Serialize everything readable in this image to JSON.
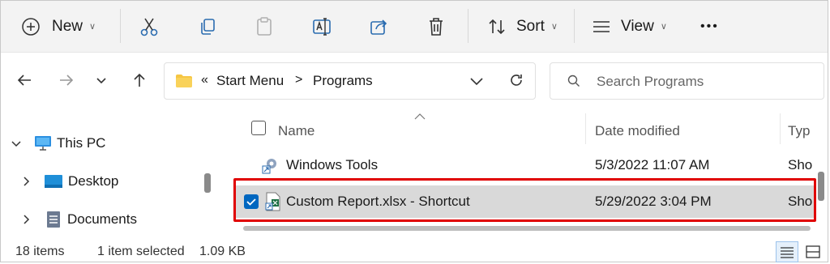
{
  "toolbar": {
    "new_label": "New",
    "sort_label": "Sort",
    "view_label": "View",
    "more_label": "•••"
  },
  "address": {
    "overflow": "«",
    "crumbs": [
      "Start Menu",
      "Programs"
    ],
    "separator": ">"
  },
  "search": {
    "placeholder": "Search Programs"
  },
  "nav": {
    "items": [
      {
        "label": "This PC",
        "expanded": true
      },
      {
        "label": "Desktop",
        "expanded": false
      },
      {
        "label": "Documents",
        "expanded": false
      }
    ]
  },
  "columns": {
    "name": "Name",
    "date": "Date modified",
    "type": "Typ"
  },
  "files": [
    {
      "name": "Windows Tools",
      "date": "5/3/2022 11:07 AM",
      "type": "Sho",
      "selected": false
    },
    {
      "name": "Custom Report.xlsx - Shortcut",
      "date": "5/29/2022 3:04 PM",
      "type": "Sho",
      "selected": true
    }
  ],
  "status": {
    "count": "18 items",
    "selection": "1 item selected",
    "size": "1.09 KB"
  },
  "colors": {
    "accent": "#0067c0",
    "highlight": "#e00000",
    "folder": "#f6c643"
  }
}
